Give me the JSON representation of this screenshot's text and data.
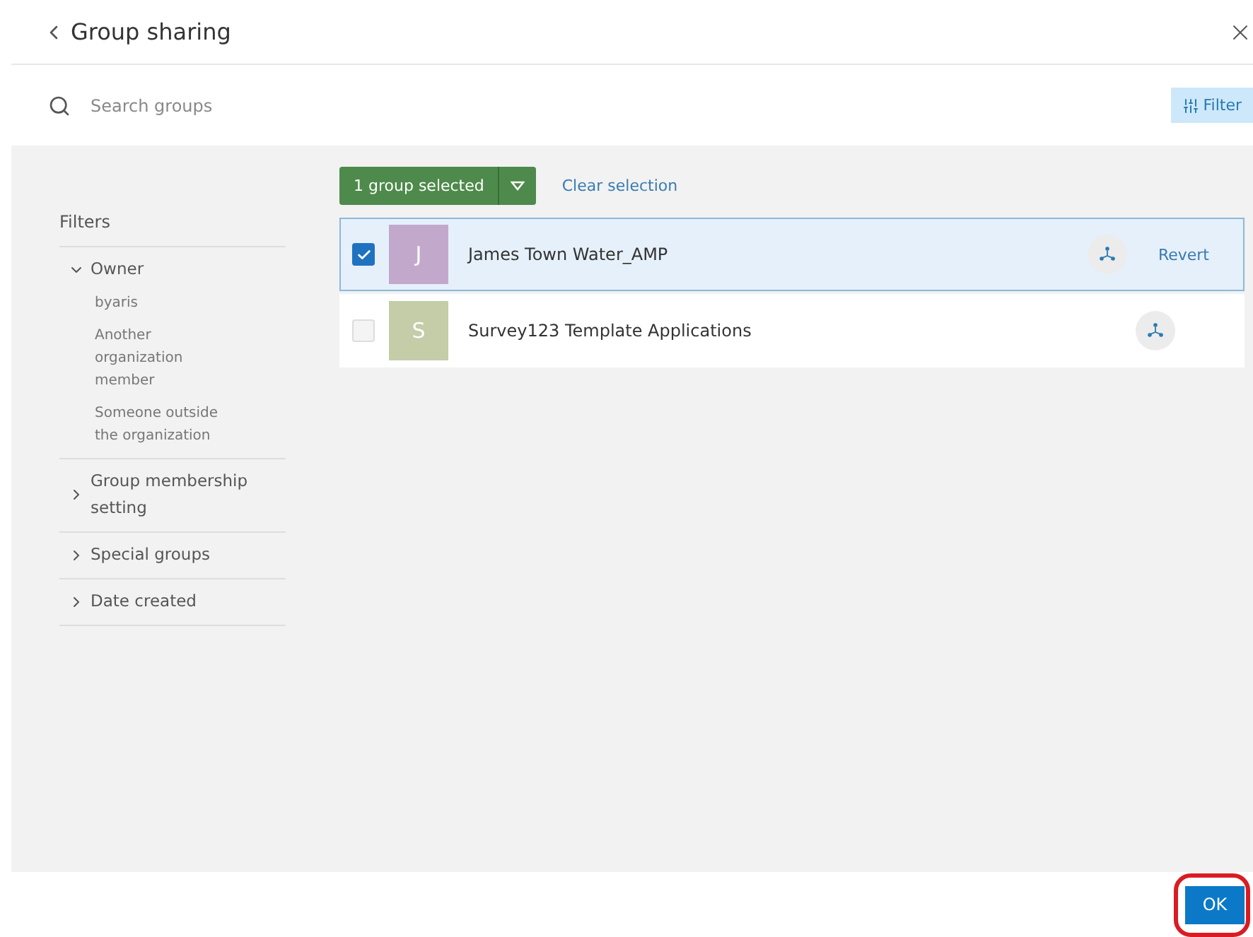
{
  "header": {
    "title": "Group sharing"
  },
  "search": {
    "placeholder": "Search groups"
  },
  "filter_button": {
    "label": "Filter",
    "selected": true
  },
  "filters": {
    "title": "Filters",
    "sections": [
      {
        "label": "Owner",
        "expanded": true,
        "options": [
          "byaris",
          "Another organization member",
          "Someone outside the organization"
        ]
      },
      {
        "label": "Group membership setting",
        "expanded": false
      },
      {
        "label": "Special groups",
        "expanded": false
      },
      {
        "label": "Date created",
        "expanded": false
      }
    ]
  },
  "selection": {
    "label": "1 group selected",
    "clear": "Clear selection"
  },
  "groups": [
    {
      "letter": "J",
      "color": "#c2a9cc",
      "name": "James Town Water_AMP",
      "selected": true,
      "action": "Revert"
    },
    {
      "letter": "S",
      "color": "#c4cca8",
      "name": "Survey123 Template Applications",
      "selected": false
    }
  ],
  "ok_button": {
    "label": "OK",
    "highlighted": true
  }
}
